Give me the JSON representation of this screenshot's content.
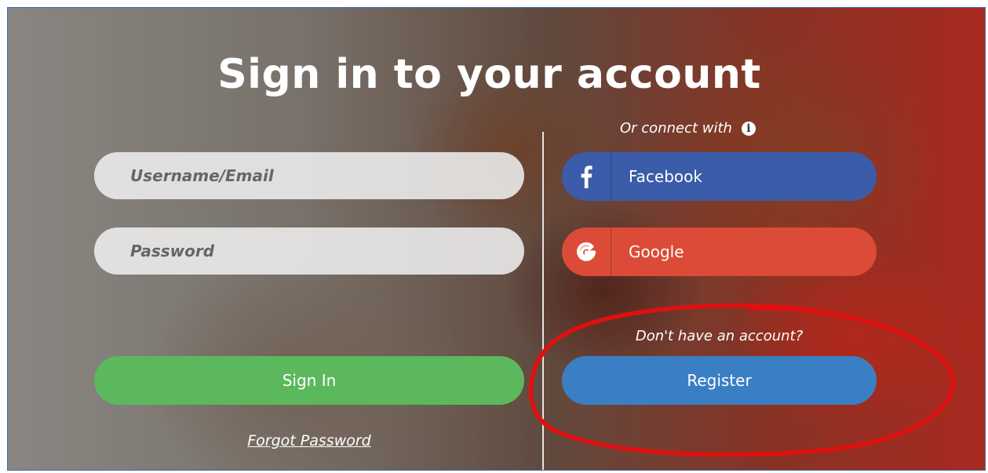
{
  "title": "Sign in to your account",
  "login_form": {
    "username_placeholder": "Username/Email",
    "password_placeholder": "Password",
    "signin_label": "Sign In",
    "forgot_label": "Forgot Password"
  },
  "social": {
    "connect_label": "Or connect with",
    "facebook_label": "Facebook",
    "google_label": "Google"
  },
  "register": {
    "prompt": "Don't have an account?",
    "button_label": "Register"
  },
  "colors": {
    "signin": "#5cb85c",
    "register": "#3a7fc4",
    "facebook": "#3b5ca8",
    "google": "#dc4b37",
    "annotation": "#e01010"
  },
  "icons": [
    "facebook-icon",
    "google-icon",
    "info-icon"
  ]
}
